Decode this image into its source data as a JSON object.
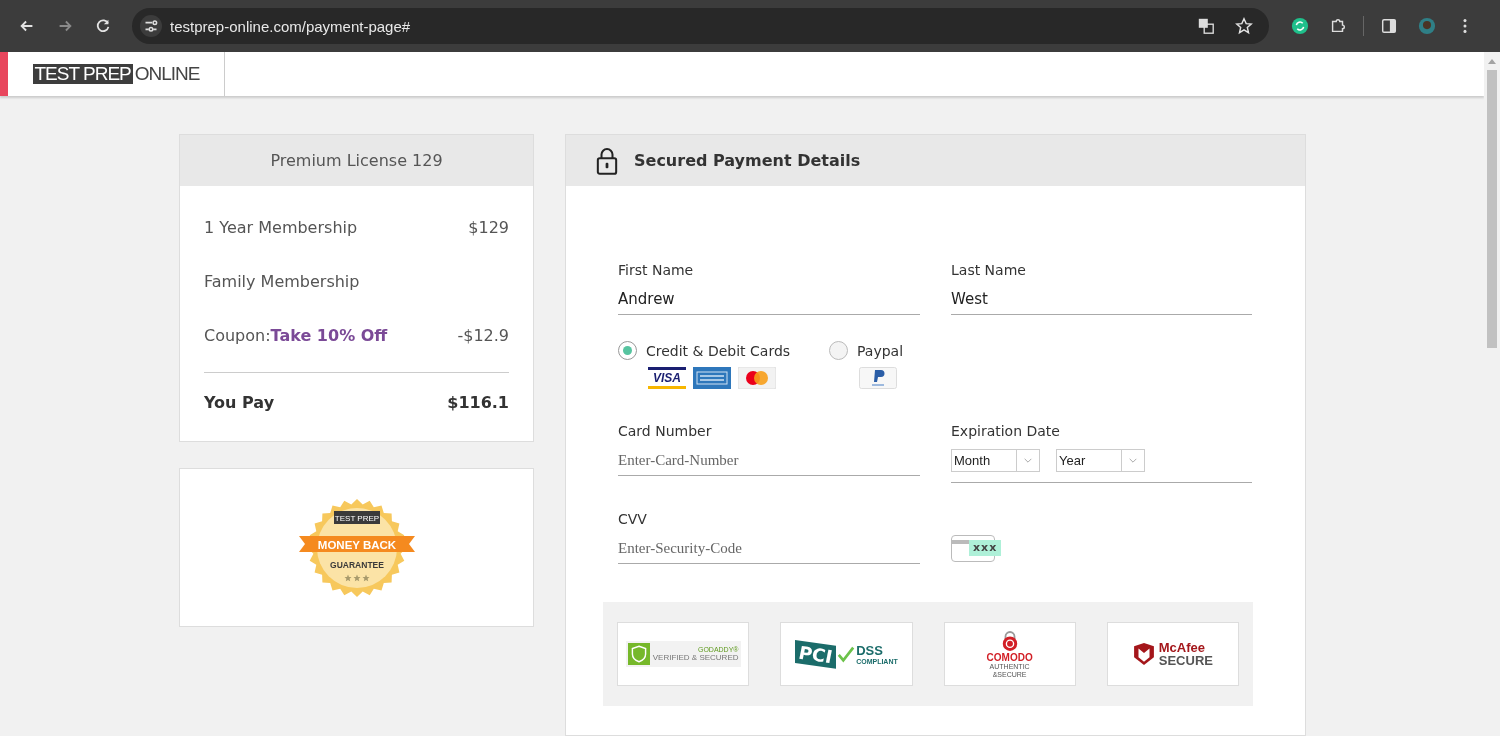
{
  "browser": {
    "url": "testprep-online.com/payment-page#"
  },
  "site_header": {
    "logo": {
      "dark_part": "TEST PREP",
      "light_part": "ONLINE"
    }
  },
  "order_summary": {
    "title": "Premium License 129",
    "rows": [
      {
        "label": "1 Year Membership",
        "amount": "$129"
      },
      {
        "label": "Family Membership"
      },
      {
        "label": "Coupon:",
        "coupon": "Take 10% Off",
        "amount": "-$12.9"
      }
    ],
    "total": {
      "label": "You Pay",
      "amount": "$116.1"
    }
  },
  "guarantee_badge": {
    "brand": "TEST PREP",
    "ribbon": "MONEY BACK",
    "subtitle": "GUARANTEE",
    "stars": 3
  },
  "payment": {
    "title": "Secured Payment Details",
    "first_name": {
      "label": "First Name",
      "value": "Andrew"
    },
    "last_name": {
      "label": "Last Name",
      "value": "West"
    },
    "methods": [
      {
        "label": "Credit & Debit Cards",
        "selected": true,
        "logos": [
          {
            "kind": "visa",
            "text": "VISA"
          },
          {
            "kind": "amex"
          },
          {
            "kind": "mastercard"
          }
        ]
      },
      {
        "label": "Paypal",
        "selected": false,
        "logos": [
          {
            "kind": "paypal"
          }
        ]
      }
    ],
    "card_number": {
      "label": "Card Number",
      "placeholder": "Enter-Card-Number"
    },
    "expiration": {
      "label": "Expiration Date",
      "month": "Month",
      "year": "Year"
    },
    "cvv": {
      "label": "CVV",
      "placeholder": "Enter-Security-Code",
      "hint": "xxx"
    },
    "seals": [
      {
        "kind": "godaddy",
        "top": "GODADDY®",
        "main": "VERIFIED & SECURED"
      },
      {
        "kind": "pci",
        "top": "PCI",
        "main": "DSS",
        "sub": "COMPLIANT"
      },
      {
        "kind": "comodo",
        "top": "COMODO",
        "main": "AUTHENTIC",
        "sub": "&SECURE"
      },
      {
        "kind": "mcafee",
        "top": "McAfee",
        "main": "SECURE"
      }
    ]
  }
}
